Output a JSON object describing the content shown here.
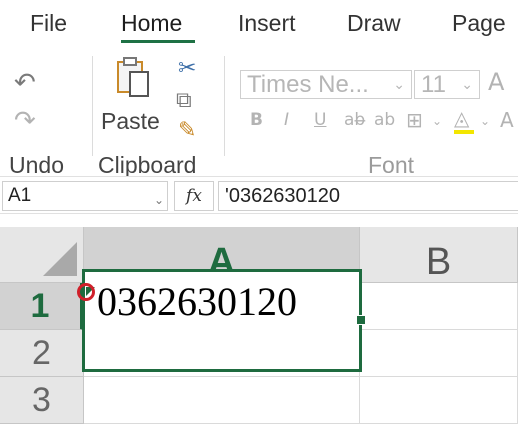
{
  "tabs": [
    {
      "label": "File"
    },
    {
      "label": "Home"
    },
    {
      "label": "Insert"
    },
    {
      "label": "Draw"
    },
    {
      "label": "Page"
    }
  ],
  "ribbon": {
    "undo_label": "Undo",
    "paste_label": "Paste",
    "clipboard_label": "Clipboard",
    "font_group_label": "Font",
    "font_name": "Times Ne...",
    "font_size": "11",
    "icons": [
      "undo-icon",
      "redo-icon",
      "paste-icon",
      "cut-icon",
      "copy-icon",
      "format-painter-icon",
      "bold-icon",
      "italic-icon",
      "underline-icon",
      "strikethrough-icon",
      "border-icon",
      "fill-color-icon",
      "increase-font-icon"
    ]
  },
  "formula_bar": {
    "name_box": "A1",
    "fx": "fx",
    "formula": "'0362630120"
  },
  "grid": {
    "columns": [
      "A",
      "B"
    ],
    "rows": [
      "1",
      "2",
      "3"
    ],
    "selected_cell": "A1",
    "cell_a1_value": "0362630120"
  },
  "colors": {
    "accent": "#1e6b3f",
    "error_indicator": "#d0202a"
  }
}
